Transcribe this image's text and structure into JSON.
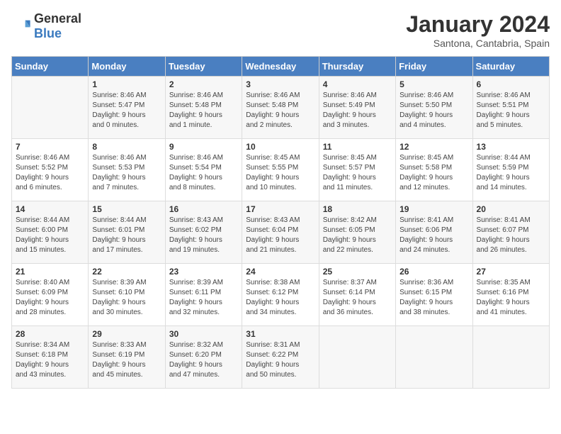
{
  "logo": {
    "general": "General",
    "blue": "Blue"
  },
  "title": "January 2024",
  "location": "Santona, Cantabria, Spain",
  "weekdays": [
    "Sunday",
    "Monday",
    "Tuesday",
    "Wednesday",
    "Thursday",
    "Friday",
    "Saturday"
  ],
  "rows": [
    [
      {
        "day": "",
        "info": ""
      },
      {
        "day": "1",
        "info": "Sunrise: 8:46 AM\nSunset: 5:47 PM\nDaylight: 9 hours\nand 0 minutes."
      },
      {
        "day": "2",
        "info": "Sunrise: 8:46 AM\nSunset: 5:48 PM\nDaylight: 9 hours\nand 1 minute."
      },
      {
        "day": "3",
        "info": "Sunrise: 8:46 AM\nSunset: 5:48 PM\nDaylight: 9 hours\nand 2 minutes."
      },
      {
        "day": "4",
        "info": "Sunrise: 8:46 AM\nSunset: 5:49 PM\nDaylight: 9 hours\nand 3 minutes."
      },
      {
        "day": "5",
        "info": "Sunrise: 8:46 AM\nSunset: 5:50 PM\nDaylight: 9 hours\nand 4 minutes."
      },
      {
        "day": "6",
        "info": "Sunrise: 8:46 AM\nSunset: 5:51 PM\nDaylight: 9 hours\nand 5 minutes."
      }
    ],
    [
      {
        "day": "7",
        "info": "Sunrise: 8:46 AM\nSunset: 5:52 PM\nDaylight: 9 hours\nand 6 minutes."
      },
      {
        "day": "8",
        "info": "Sunrise: 8:46 AM\nSunset: 5:53 PM\nDaylight: 9 hours\nand 7 minutes."
      },
      {
        "day": "9",
        "info": "Sunrise: 8:46 AM\nSunset: 5:54 PM\nDaylight: 9 hours\nand 8 minutes."
      },
      {
        "day": "10",
        "info": "Sunrise: 8:45 AM\nSunset: 5:55 PM\nDaylight: 9 hours\nand 10 minutes."
      },
      {
        "day": "11",
        "info": "Sunrise: 8:45 AM\nSunset: 5:57 PM\nDaylight: 9 hours\nand 11 minutes."
      },
      {
        "day": "12",
        "info": "Sunrise: 8:45 AM\nSunset: 5:58 PM\nDaylight: 9 hours\nand 12 minutes."
      },
      {
        "day": "13",
        "info": "Sunrise: 8:44 AM\nSunset: 5:59 PM\nDaylight: 9 hours\nand 14 minutes."
      }
    ],
    [
      {
        "day": "14",
        "info": "Sunrise: 8:44 AM\nSunset: 6:00 PM\nDaylight: 9 hours\nand 15 minutes."
      },
      {
        "day": "15",
        "info": "Sunrise: 8:44 AM\nSunset: 6:01 PM\nDaylight: 9 hours\nand 17 minutes."
      },
      {
        "day": "16",
        "info": "Sunrise: 8:43 AM\nSunset: 6:02 PM\nDaylight: 9 hours\nand 19 minutes."
      },
      {
        "day": "17",
        "info": "Sunrise: 8:43 AM\nSunset: 6:04 PM\nDaylight: 9 hours\nand 21 minutes."
      },
      {
        "day": "18",
        "info": "Sunrise: 8:42 AM\nSunset: 6:05 PM\nDaylight: 9 hours\nand 22 minutes."
      },
      {
        "day": "19",
        "info": "Sunrise: 8:41 AM\nSunset: 6:06 PM\nDaylight: 9 hours\nand 24 minutes."
      },
      {
        "day": "20",
        "info": "Sunrise: 8:41 AM\nSunset: 6:07 PM\nDaylight: 9 hours\nand 26 minutes."
      }
    ],
    [
      {
        "day": "21",
        "info": "Sunrise: 8:40 AM\nSunset: 6:09 PM\nDaylight: 9 hours\nand 28 minutes."
      },
      {
        "day": "22",
        "info": "Sunrise: 8:39 AM\nSunset: 6:10 PM\nDaylight: 9 hours\nand 30 minutes."
      },
      {
        "day": "23",
        "info": "Sunrise: 8:39 AM\nSunset: 6:11 PM\nDaylight: 9 hours\nand 32 minutes."
      },
      {
        "day": "24",
        "info": "Sunrise: 8:38 AM\nSunset: 6:12 PM\nDaylight: 9 hours\nand 34 minutes."
      },
      {
        "day": "25",
        "info": "Sunrise: 8:37 AM\nSunset: 6:14 PM\nDaylight: 9 hours\nand 36 minutes."
      },
      {
        "day": "26",
        "info": "Sunrise: 8:36 AM\nSunset: 6:15 PM\nDaylight: 9 hours\nand 38 minutes."
      },
      {
        "day": "27",
        "info": "Sunrise: 8:35 AM\nSunset: 6:16 PM\nDaylight: 9 hours\nand 41 minutes."
      }
    ],
    [
      {
        "day": "28",
        "info": "Sunrise: 8:34 AM\nSunset: 6:18 PM\nDaylight: 9 hours\nand 43 minutes."
      },
      {
        "day": "29",
        "info": "Sunrise: 8:33 AM\nSunset: 6:19 PM\nDaylight: 9 hours\nand 45 minutes."
      },
      {
        "day": "30",
        "info": "Sunrise: 8:32 AM\nSunset: 6:20 PM\nDaylight: 9 hours\nand 47 minutes."
      },
      {
        "day": "31",
        "info": "Sunrise: 8:31 AM\nSunset: 6:22 PM\nDaylight: 9 hours\nand 50 minutes."
      },
      {
        "day": "",
        "info": ""
      },
      {
        "day": "",
        "info": ""
      },
      {
        "day": "",
        "info": ""
      }
    ]
  ]
}
